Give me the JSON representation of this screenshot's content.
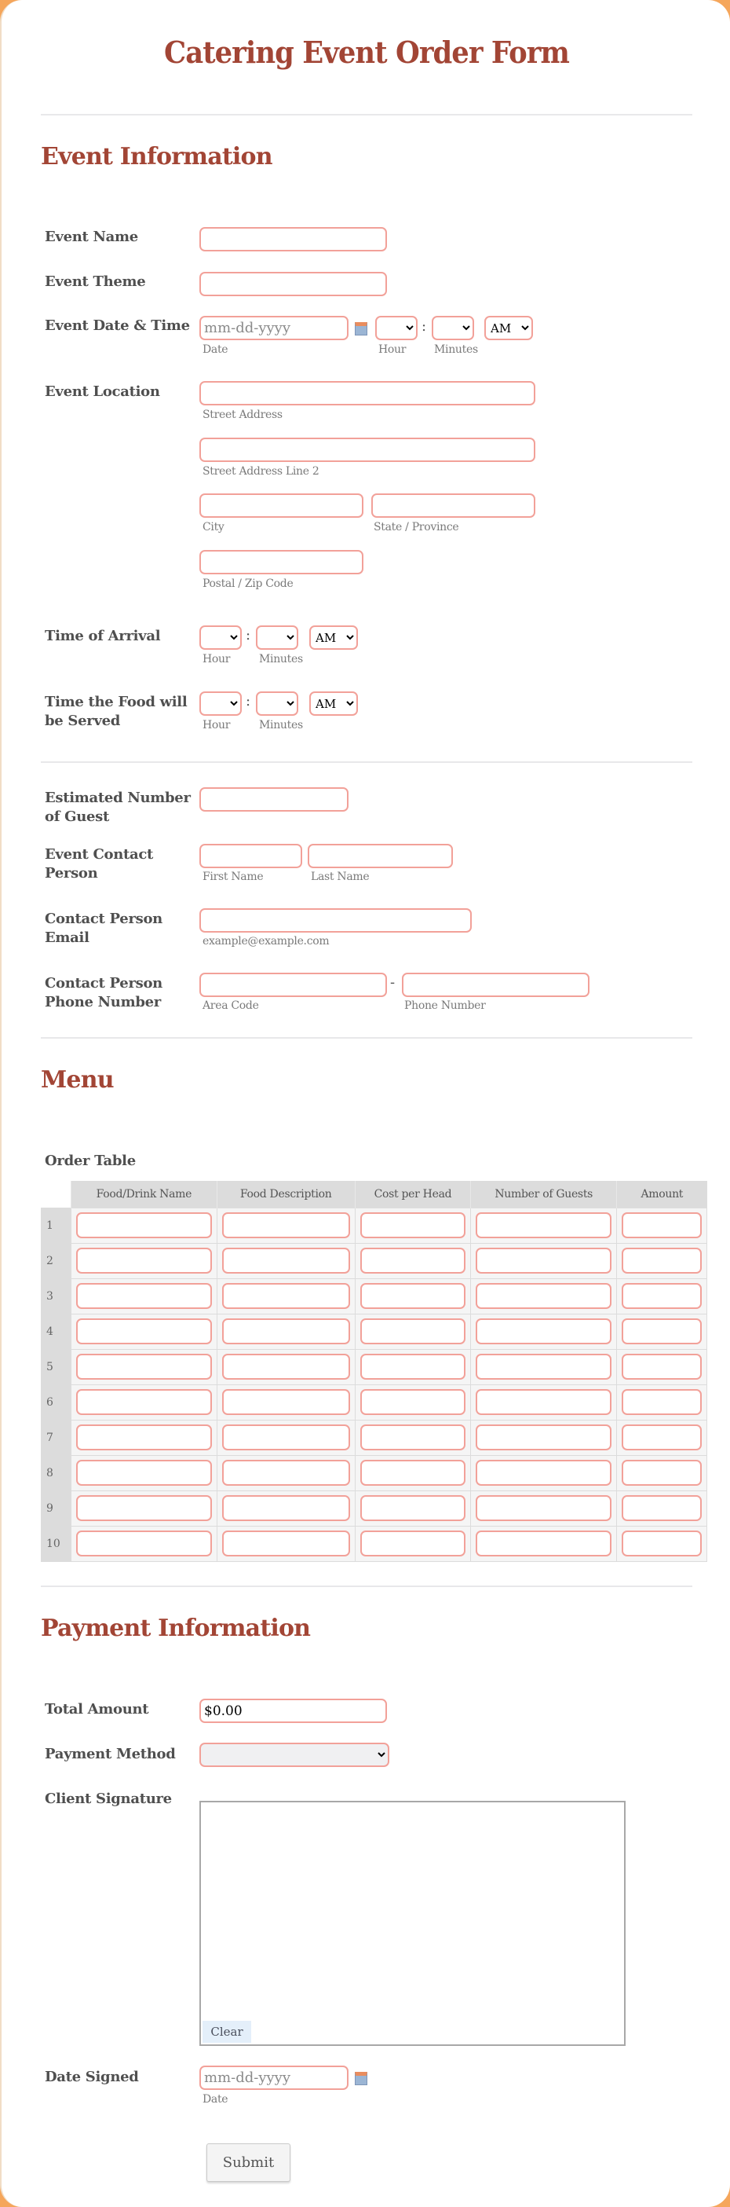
{
  "form": {
    "title": "Catering Event Order Form",
    "submit_label": "Submit"
  },
  "event_info": {
    "heading": "Event Information",
    "event_name": {
      "label": "Event Name",
      "value": ""
    },
    "event_theme": {
      "label": "Event Theme",
      "value": ""
    },
    "event_datetime": {
      "label": "Event Date & Time",
      "date_placeholder": "mm-dd-yyyy",
      "date_sublabel": "Date",
      "hour_sublabel": "Hour",
      "minutes_sublabel": "Minutes",
      "ampm_value": "AM"
    },
    "location": {
      "label": "Event Location",
      "street_sublabel": "Street Address",
      "street2_sublabel": "Street Address Line 2",
      "city_sublabel": "City",
      "state_sublabel": "State / Province",
      "zip_sublabel": "Postal / Zip Code"
    },
    "arrival": {
      "label": "Time of Arrival",
      "hour_sublabel": "Hour",
      "minutes_sublabel": "Minutes",
      "ampm_value": "AM"
    },
    "served": {
      "label": "Time the Food will be Served",
      "hour_sublabel": "Hour",
      "minutes_sublabel": "Minutes",
      "ampm_value": "AM"
    }
  },
  "contact": {
    "guests": {
      "label": "Estimated Number of Guest"
    },
    "person": {
      "label": "Event Contact Person",
      "first_sublabel": "First Name",
      "last_sublabel": "Last Name"
    },
    "email": {
      "label": "Contact Person Email",
      "sublabel": "example@example.com"
    },
    "phone": {
      "label": "Contact Person Phone Number",
      "area_sublabel": "Area Code",
      "number_sublabel": "Phone Number",
      "separator": "-"
    }
  },
  "menu": {
    "heading": "Menu",
    "table_label": "Order Table",
    "columns": [
      "Food/Drink Name",
      "Food Description",
      "Cost per Head",
      "Number of Guests",
      "Amount"
    ],
    "rows": [
      "1",
      "2",
      "3",
      "4",
      "5",
      "6",
      "7",
      "8",
      "9",
      "10"
    ]
  },
  "payment": {
    "heading": "Payment Information",
    "total": {
      "label": "Total Amount",
      "value": "$0.00"
    },
    "method": {
      "label": "Payment Method",
      "value": ""
    },
    "signature": {
      "label": "Client Signature",
      "clear_label": "Clear"
    },
    "date_signed": {
      "label": "Date Signed",
      "placeholder": "mm-dd-yyyy",
      "sublabel": "Date"
    }
  },
  "colors": {
    "accent": "#a24535",
    "input_border": "#f2a199",
    "background": "#f5a65b"
  }
}
